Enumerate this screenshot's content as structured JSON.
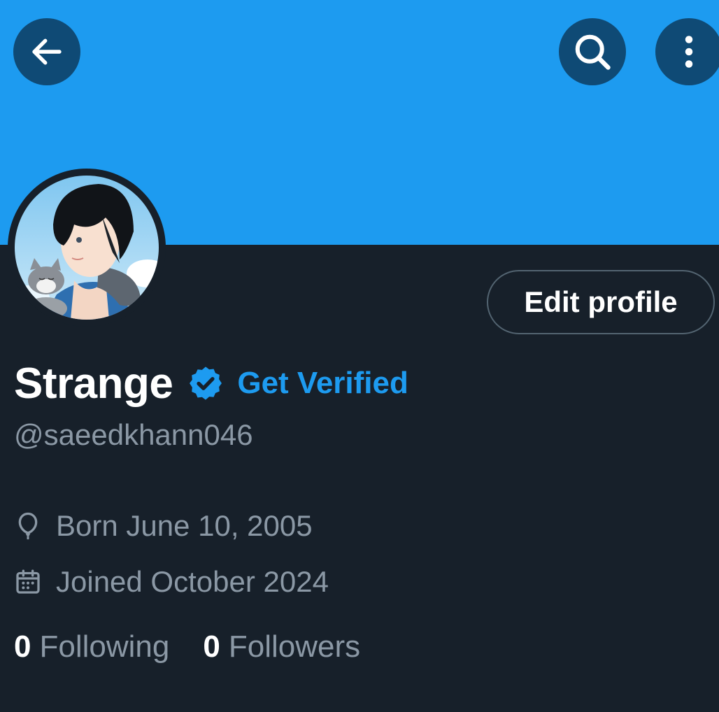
{
  "header": {
    "back_icon": "arrow-left-icon",
    "search_icon": "search-icon",
    "more_icon": "more-vertical-icon",
    "banner_color": "#1d9bf0"
  },
  "profile": {
    "display_name": "Strange",
    "verified_icon": "verified-badge-icon",
    "get_verified_label": "Get Verified",
    "handle": "@saeedkhann046",
    "edit_profile_label": "Edit profile",
    "born": "Born June 10, 2005",
    "born_icon": "balloon-icon",
    "joined": "Joined October 2024",
    "joined_icon": "calendar-icon",
    "following_count": "0",
    "following_label": "Following",
    "followers_count": "0",
    "followers_label": "Followers"
  },
  "colors": {
    "accent": "#1d9bf0",
    "background": "#17202a",
    "secondary_text": "#8b98a5",
    "primary_text": "#ffffff"
  }
}
